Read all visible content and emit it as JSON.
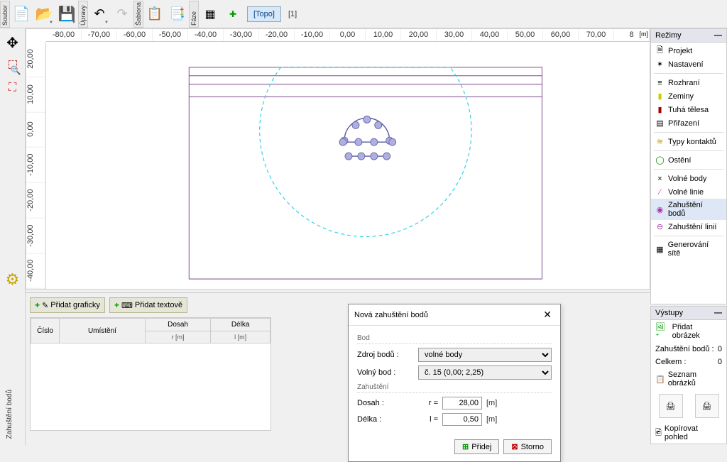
{
  "toolbar": {
    "labels": {
      "file": "Soubor",
      "edit": "Úpravy",
      "template": "Šablona",
      "phase": "Fáze"
    },
    "topo_button": "[Topo]",
    "phase_indicator": "[1]"
  },
  "ruler": {
    "top": [
      "-80,00",
      "-70,00",
      "-60,00",
      "-50,00",
      "-40,00",
      "-30,00",
      "-20,00",
      "-10,00",
      "0,00",
      "10,00",
      "20,00",
      "30,00",
      "40,00",
      "50,00",
      "60,00",
      "70,00",
      "8"
    ],
    "unit": "[m]",
    "left": [
      "20,00",
      "10,00",
      "0,00",
      "-10,00",
      "-20,00",
      "-30,00",
      "-40,00"
    ]
  },
  "bottom": {
    "add_graphic": "Přidat graficky",
    "add_text": "Přidat textově",
    "side_label": "Zahuštění bodů",
    "cols": {
      "num": "Číslo",
      "loc": "Umístění",
      "reach": "Dosah",
      "len": "Délka",
      "reach_u": "r  [m]",
      "len_u": "l [m]"
    }
  },
  "dialog": {
    "title": "Nová zahuštění bodů",
    "group_point": "Bod",
    "group_dens": "Zahuštění",
    "src_label": "Zdroj bodů :",
    "src_value": "volné body",
    "free_label": "Volný bod :",
    "free_value": "č. 15 (0,00; 2,25)",
    "reach_label": "Dosah :",
    "reach_sym": "r =",
    "reach_val": "28,00",
    "len_label": "Délka :",
    "len_sym": "l =",
    "len_val": "0,50",
    "unit": "[m]",
    "add": "Přidej",
    "cancel": "Storno"
  },
  "modes": {
    "title": "Režimy",
    "items": {
      "project": "Projekt",
      "settings": "Nastavení",
      "interface": "Rozhraní",
      "soils": "Zeminy",
      "rigid": "Tuhá tělesa",
      "assign": "Přiřazení",
      "contacts": "Typy kontaktů",
      "lining": "Ostění",
      "fpoints": "Volné body",
      "flines": "Volné linie",
      "dpoints": "Zahuštění bodů",
      "dlines": "Zahuštění linií",
      "meshgen": "Generování sítě"
    }
  },
  "outputs": {
    "title": "Výstupy",
    "add_image": "Přidat obrázek",
    "row1_l": "Zahuštění bodů :",
    "row1_v": "0",
    "row2_l": "Celkem :",
    "row2_v": "0",
    "list": "Seznam obrázků",
    "copy_view": "Kopírovat pohled"
  }
}
